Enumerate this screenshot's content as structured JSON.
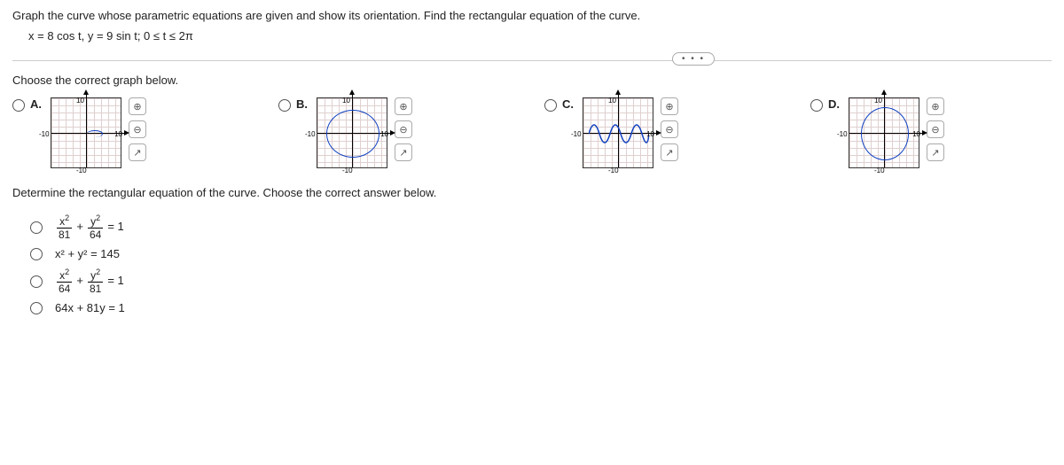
{
  "question": {
    "line1": "Graph the curve whose parametric equations are given and show its orientation. Find the rectangular equation of the curve.",
    "equation": "x = 8 cos t,  y = 9 sin t;   0 ≤ t ≤ 2π"
  },
  "graph_prompt": "Choose the correct graph below.",
  "options": {
    "a": {
      "label": "A."
    },
    "b": {
      "label": "B."
    },
    "c": {
      "label": "C."
    },
    "d": {
      "label": "D."
    }
  },
  "ticks": {
    "pos": "10",
    "neg": "-10"
  },
  "tools": {
    "zoom_in": "⊕",
    "zoom_out": "⊖",
    "popout": "↗"
  },
  "ellipsis": "• • •",
  "eq_prompt": "Determine the rectangular equation of the curve. Choose the correct answer below.",
  "eq_options": {
    "opt1": {
      "num1": "x",
      "den1": "81",
      "num2": "y",
      "den2": "64",
      "rhs": "= 1",
      "plus": "+"
    },
    "opt2": {
      "text": "x² + y² = 145"
    },
    "opt3": {
      "num1": "x",
      "den1": "64",
      "num2": "y",
      "den2": "81",
      "rhs": "= 1",
      "plus": "+"
    },
    "opt4": {
      "text": "64x + 81y = 1"
    }
  },
  "chart_data": [
    {
      "type": "parametric-plot",
      "label": "A",
      "shape": "small-directed-arc",
      "xlim": [
        -10,
        10
      ],
      "ylim": [
        -10,
        10
      ]
    },
    {
      "type": "parametric-plot",
      "label": "B",
      "shape": "ellipse-horizontal",
      "a": 9,
      "b": 8,
      "xlim": [
        -10,
        10
      ],
      "ylim": [
        -10,
        10
      ]
    },
    {
      "type": "parametric-plot",
      "label": "C",
      "shape": "sine-like-multiarc",
      "xlim": [
        -10,
        10
      ],
      "ylim": [
        -10,
        10
      ]
    },
    {
      "type": "parametric-plot",
      "label": "D",
      "shape": "ellipse-vertical",
      "a": 8,
      "b": 9,
      "xlim": [
        -10,
        10
      ],
      "ylim": [
        -10,
        10
      ]
    }
  ]
}
